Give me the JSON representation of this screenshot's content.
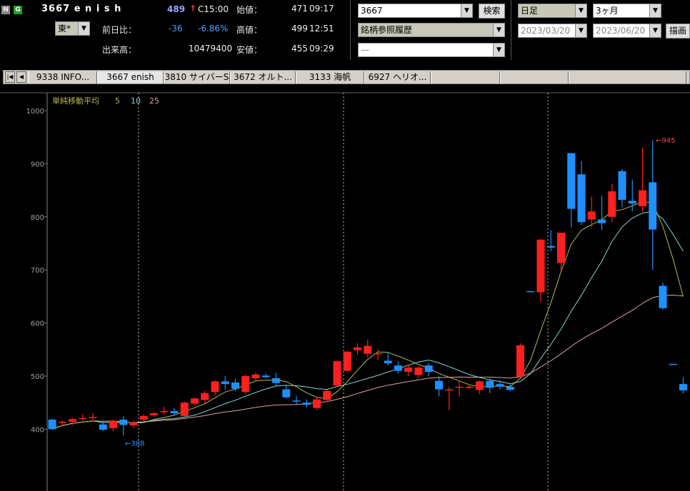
{
  "header": {
    "badge_n": "N",
    "badge_g": "G",
    "symbol_title": "3667 e n i s h",
    "price": "489",
    "price_arrow": "↑",
    "price_time": "C15:00",
    "market": "東*",
    "change_label": "前日比：",
    "change": "-36",
    "change_pct": "-6.86%",
    "volume_label": "出来高：",
    "volume": "10479400",
    "open_label": "始値：",
    "open": "471",
    "open_time": "09:17",
    "high_label": "高値：",
    "high": "499",
    "high_time": "12:51",
    "low_label": "安値：",
    "low": "455",
    "low_time": "09:29"
  },
  "search": {
    "code_value": "3667",
    "search_button": "検索",
    "history_value": "銘柄参照履歴",
    "third_value": "—"
  },
  "period": {
    "interval": "日足",
    "span": "3ヶ月",
    "start_date": "2023/03/20",
    "end_date": "2023/06/20",
    "draw_button": "描画"
  },
  "tabs": {
    "first_icon": "first-icon",
    "prev_icon": "prev-icon",
    "items": [
      {
        "label": "9338 INFO..."
      },
      {
        "label": "3667 enish",
        "active": true
      },
      {
        "label": "3810 サイバーS"
      },
      {
        "label": "3672 オルト..."
      },
      {
        "label": "3133 海帆"
      },
      {
        "label": "6927 ヘリオ..."
      },
      {
        "label": ""
      },
      {
        "label": ""
      },
      {
        "label": ""
      }
    ]
  },
  "chart_data": {
    "type": "candlestick",
    "legend_title": "単純移動平均",
    "ma_periods": [
      "5",
      "10",
      "25"
    ],
    "ylim": [
      370,
      1010
    ],
    "yticks": [
      400,
      500,
      600,
      700,
      800,
      900,
      1000
    ],
    "grid": false,
    "annotation_high": "←945",
    "annotation_low": "←388",
    "colors": {
      "up": "#ff2020",
      "down": "#1e90ff",
      "ma5": "#b8b850",
      "ma10": "#7fd8d8",
      "ma25": "#e0a0a0",
      "bg": "#000000",
      "axis": "#808080",
      "annotation": "#ff4040",
      "annotation_low": "#3090ff"
    },
    "candles": [
      [
        418,
        420,
        400,
        400
      ],
      [
        412,
        416,
        407,
        414
      ],
      [
        414,
        421,
        408,
        419
      ],
      [
        419,
        428,
        416,
        421
      ],
      [
        421,
        430,
        417,
        423
      ],
      [
        409,
        415,
        397,
        399
      ],
      [
        402,
        418,
        397,
        416
      ],
      [
        418,
        425,
        388,
        408
      ],
      [
        407,
        416,
        402,
        413
      ],
      [
        418,
        428,
        413,
        425
      ],
      [
        426,
        432,
        423,
        430
      ],
      [
        432,
        442,
        428,
        434
      ],
      [
        434,
        440,
        425,
        430
      ],
      [
        425,
        452,
        424,
        450
      ],
      [
        448,
        460,
        444,
        458
      ],
      [
        455,
        472,
        449,
        468
      ],
      [
        470,
        492,
        464,
        490
      ],
      [
        490,
        500,
        475,
        485
      ],
      [
        488,
        495,
        472,
        476
      ],
      [
        470,
        503,
        466,
        500
      ],
      [
        496,
        507,
        490,
        503
      ],
      [
        501,
        505,
        496,
        498
      ],
      [
        496,
        506,
        480,
        487
      ],
      [
        475,
        482,
        458,
        460
      ],
      [
        454,
        462,
        447,
        452
      ],
      [
        450,
        456,
        441,
        446
      ],
      [
        440,
        460,
        436,
        456
      ],
      [
        455,
        475,
        451,
        472
      ],
      [
        482,
        530,
        480,
        528
      ],
      [
        510,
        548,
        508,
        546
      ],
      [
        549,
        562,
        540,
        554
      ],
      [
        542,
        569,
        535,
        557
      ],
      [
        543,
        550,
        530,
        543
      ],
      [
        529,
        545,
        520,
        524
      ],
      [
        520,
        528,
        505,
        510
      ],
      [
        508,
        520,
        500,
        516
      ],
      [
        502,
        518,
        496,
        516
      ],
      [
        520,
        524,
        500,
        508
      ],
      [
        491,
        500,
        462,
        475
      ],
      [
        475,
        480,
        436,
        475
      ],
      [
        478,
        492,
        461,
        480
      ],
      [
        480,
        484,
        476,
        480
      ],
      [
        474,
        492,
        466,
        490
      ],
      [
        491,
        496,
        468,
        478
      ],
      [
        485,
        492,
        475,
        480
      ],
      [
        480,
        486,
        472,
        474
      ],
      [
        499,
        562,
        497,
        558
      ],
      [
        660,
        660,
        659,
        659
      ],
      [
        658,
        758,
        640,
        757
      ],
      [
        745,
        775,
        735,
        742
      ],
      [
        713,
        760,
        700,
        770
      ],
      [
        920,
        920,
        780,
        815
      ],
      [
        880,
        905,
        785,
        790
      ],
      [
        795,
        838,
        780,
        810
      ],
      [
        795,
        840,
        775,
        788
      ],
      [
        800,
        862,
        790,
        848
      ],
      [
        886,
        890,
        818,
        832
      ],
      [
        830,
        870,
        810,
        825
      ],
      [
        820,
        930,
        810,
        850
      ],
      [
        865,
        945,
        700,
        776
      ],
      [
        670,
        676,
        625,
        628
      ],
      [
        523,
        523,
        522,
        522
      ],
      [
        485,
        498,
        467,
        473
      ]
    ]
  }
}
